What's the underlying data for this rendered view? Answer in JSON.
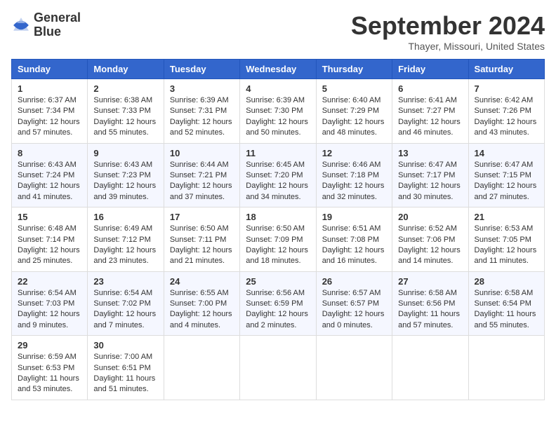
{
  "logo": {
    "line1": "General",
    "line2": "Blue"
  },
  "header": {
    "month_year": "September 2024",
    "location": "Thayer, Missouri, United States"
  },
  "days_of_week": [
    "Sunday",
    "Monday",
    "Tuesday",
    "Wednesday",
    "Thursday",
    "Friday",
    "Saturday"
  ],
  "weeks": [
    [
      {
        "day": "1",
        "sunrise": "Sunrise: 6:37 AM",
        "sunset": "Sunset: 7:34 PM",
        "daylight": "Daylight: 12 hours and 57 minutes."
      },
      {
        "day": "2",
        "sunrise": "Sunrise: 6:38 AM",
        "sunset": "Sunset: 7:33 PM",
        "daylight": "Daylight: 12 hours and 55 minutes."
      },
      {
        "day": "3",
        "sunrise": "Sunrise: 6:39 AM",
        "sunset": "Sunset: 7:31 PM",
        "daylight": "Daylight: 12 hours and 52 minutes."
      },
      {
        "day": "4",
        "sunrise": "Sunrise: 6:39 AM",
        "sunset": "Sunset: 7:30 PM",
        "daylight": "Daylight: 12 hours and 50 minutes."
      },
      {
        "day": "5",
        "sunrise": "Sunrise: 6:40 AM",
        "sunset": "Sunset: 7:29 PM",
        "daylight": "Daylight: 12 hours and 48 minutes."
      },
      {
        "day": "6",
        "sunrise": "Sunrise: 6:41 AM",
        "sunset": "Sunset: 7:27 PM",
        "daylight": "Daylight: 12 hours and 46 minutes."
      },
      {
        "day": "7",
        "sunrise": "Sunrise: 6:42 AM",
        "sunset": "Sunset: 7:26 PM",
        "daylight": "Daylight: 12 hours and 43 minutes."
      }
    ],
    [
      {
        "day": "8",
        "sunrise": "Sunrise: 6:43 AM",
        "sunset": "Sunset: 7:24 PM",
        "daylight": "Daylight: 12 hours and 41 minutes."
      },
      {
        "day": "9",
        "sunrise": "Sunrise: 6:43 AM",
        "sunset": "Sunset: 7:23 PM",
        "daylight": "Daylight: 12 hours and 39 minutes."
      },
      {
        "day": "10",
        "sunrise": "Sunrise: 6:44 AM",
        "sunset": "Sunset: 7:21 PM",
        "daylight": "Daylight: 12 hours and 37 minutes."
      },
      {
        "day": "11",
        "sunrise": "Sunrise: 6:45 AM",
        "sunset": "Sunset: 7:20 PM",
        "daylight": "Daylight: 12 hours and 34 minutes."
      },
      {
        "day": "12",
        "sunrise": "Sunrise: 6:46 AM",
        "sunset": "Sunset: 7:18 PM",
        "daylight": "Daylight: 12 hours and 32 minutes."
      },
      {
        "day": "13",
        "sunrise": "Sunrise: 6:47 AM",
        "sunset": "Sunset: 7:17 PM",
        "daylight": "Daylight: 12 hours and 30 minutes."
      },
      {
        "day": "14",
        "sunrise": "Sunrise: 6:47 AM",
        "sunset": "Sunset: 7:15 PM",
        "daylight": "Daylight: 12 hours and 27 minutes."
      }
    ],
    [
      {
        "day": "15",
        "sunrise": "Sunrise: 6:48 AM",
        "sunset": "Sunset: 7:14 PM",
        "daylight": "Daylight: 12 hours and 25 minutes."
      },
      {
        "day": "16",
        "sunrise": "Sunrise: 6:49 AM",
        "sunset": "Sunset: 7:12 PM",
        "daylight": "Daylight: 12 hours and 23 minutes."
      },
      {
        "day": "17",
        "sunrise": "Sunrise: 6:50 AM",
        "sunset": "Sunset: 7:11 PM",
        "daylight": "Daylight: 12 hours and 21 minutes."
      },
      {
        "day": "18",
        "sunrise": "Sunrise: 6:50 AM",
        "sunset": "Sunset: 7:09 PM",
        "daylight": "Daylight: 12 hours and 18 minutes."
      },
      {
        "day": "19",
        "sunrise": "Sunrise: 6:51 AM",
        "sunset": "Sunset: 7:08 PM",
        "daylight": "Daylight: 12 hours and 16 minutes."
      },
      {
        "day": "20",
        "sunrise": "Sunrise: 6:52 AM",
        "sunset": "Sunset: 7:06 PM",
        "daylight": "Daylight: 12 hours and 14 minutes."
      },
      {
        "day": "21",
        "sunrise": "Sunrise: 6:53 AM",
        "sunset": "Sunset: 7:05 PM",
        "daylight": "Daylight: 12 hours and 11 minutes."
      }
    ],
    [
      {
        "day": "22",
        "sunrise": "Sunrise: 6:54 AM",
        "sunset": "Sunset: 7:03 PM",
        "daylight": "Daylight: 12 hours and 9 minutes."
      },
      {
        "day": "23",
        "sunrise": "Sunrise: 6:54 AM",
        "sunset": "Sunset: 7:02 PM",
        "daylight": "Daylight: 12 hours and 7 minutes."
      },
      {
        "day": "24",
        "sunrise": "Sunrise: 6:55 AM",
        "sunset": "Sunset: 7:00 PM",
        "daylight": "Daylight: 12 hours and 4 minutes."
      },
      {
        "day": "25",
        "sunrise": "Sunrise: 6:56 AM",
        "sunset": "Sunset: 6:59 PM",
        "daylight": "Daylight: 12 hours and 2 minutes."
      },
      {
        "day": "26",
        "sunrise": "Sunrise: 6:57 AM",
        "sunset": "Sunset: 6:57 PM",
        "daylight": "Daylight: 12 hours and 0 minutes."
      },
      {
        "day": "27",
        "sunrise": "Sunrise: 6:58 AM",
        "sunset": "Sunset: 6:56 PM",
        "daylight": "Daylight: 11 hours and 57 minutes."
      },
      {
        "day": "28",
        "sunrise": "Sunrise: 6:58 AM",
        "sunset": "Sunset: 6:54 PM",
        "daylight": "Daylight: 11 hours and 55 minutes."
      }
    ],
    [
      {
        "day": "29",
        "sunrise": "Sunrise: 6:59 AM",
        "sunset": "Sunset: 6:53 PM",
        "daylight": "Daylight: 11 hours and 53 minutes."
      },
      {
        "day": "30",
        "sunrise": "Sunrise: 7:00 AM",
        "sunset": "Sunset: 6:51 PM",
        "daylight": "Daylight: 11 hours and 51 minutes."
      },
      null,
      null,
      null,
      null,
      null
    ]
  ]
}
